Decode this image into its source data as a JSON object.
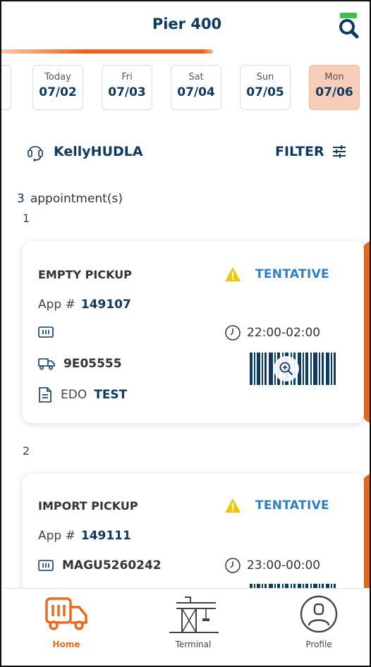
{
  "header": {
    "title": "Pier 400"
  },
  "dates": [
    {
      "day": "Today",
      "date": "07/02",
      "active": false
    },
    {
      "day": "Fri",
      "date": "07/03",
      "active": false
    },
    {
      "day": "Sat",
      "date": "07/04",
      "active": false
    },
    {
      "day": "Sun",
      "date": "07/05",
      "active": false
    },
    {
      "day": "Mon",
      "date": "07/06",
      "active": true
    }
  ],
  "user": {
    "name": "KellyHUDLA",
    "icon": "headset-icon"
  },
  "filter": {
    "label": "FILTER",
    "icon": "sliders-icon"
  },
  "summary": {
    "count": "3",
    "label": "appointment(s)"
  },
  "appointments": [
    {
      "index": "1",
      "type": "EMPTY PICKUP",
      "status": "TENTATIVE",
      "app_label": "App #",
      "app_number": "149107",
      "container": "",
      "time": "22:00-02:00",
      "truck": "9E05555",
      "doc_label": "EDO",
      "doc_value": "TEST"
    },
    {
      "index": "2",
      "type": "IMPORT PICKUP",
      "status": "TENTATIVE",
      "app_label": "App #",
      "app_number": "149111",
      "container": "MAGU5260242",
      "time": "23:00-00:00"
    }
  ],
  "nav": {
    "home": "Home",
    "terminal": "Terminal",
    "profile": "Profile"
  },
  "colors": {
    "accent": "#ea6a1f",
    "primary": "#0d3a63",
    "status": "#2d7fc7",
    "warning": "#f5c400"
  }
}
